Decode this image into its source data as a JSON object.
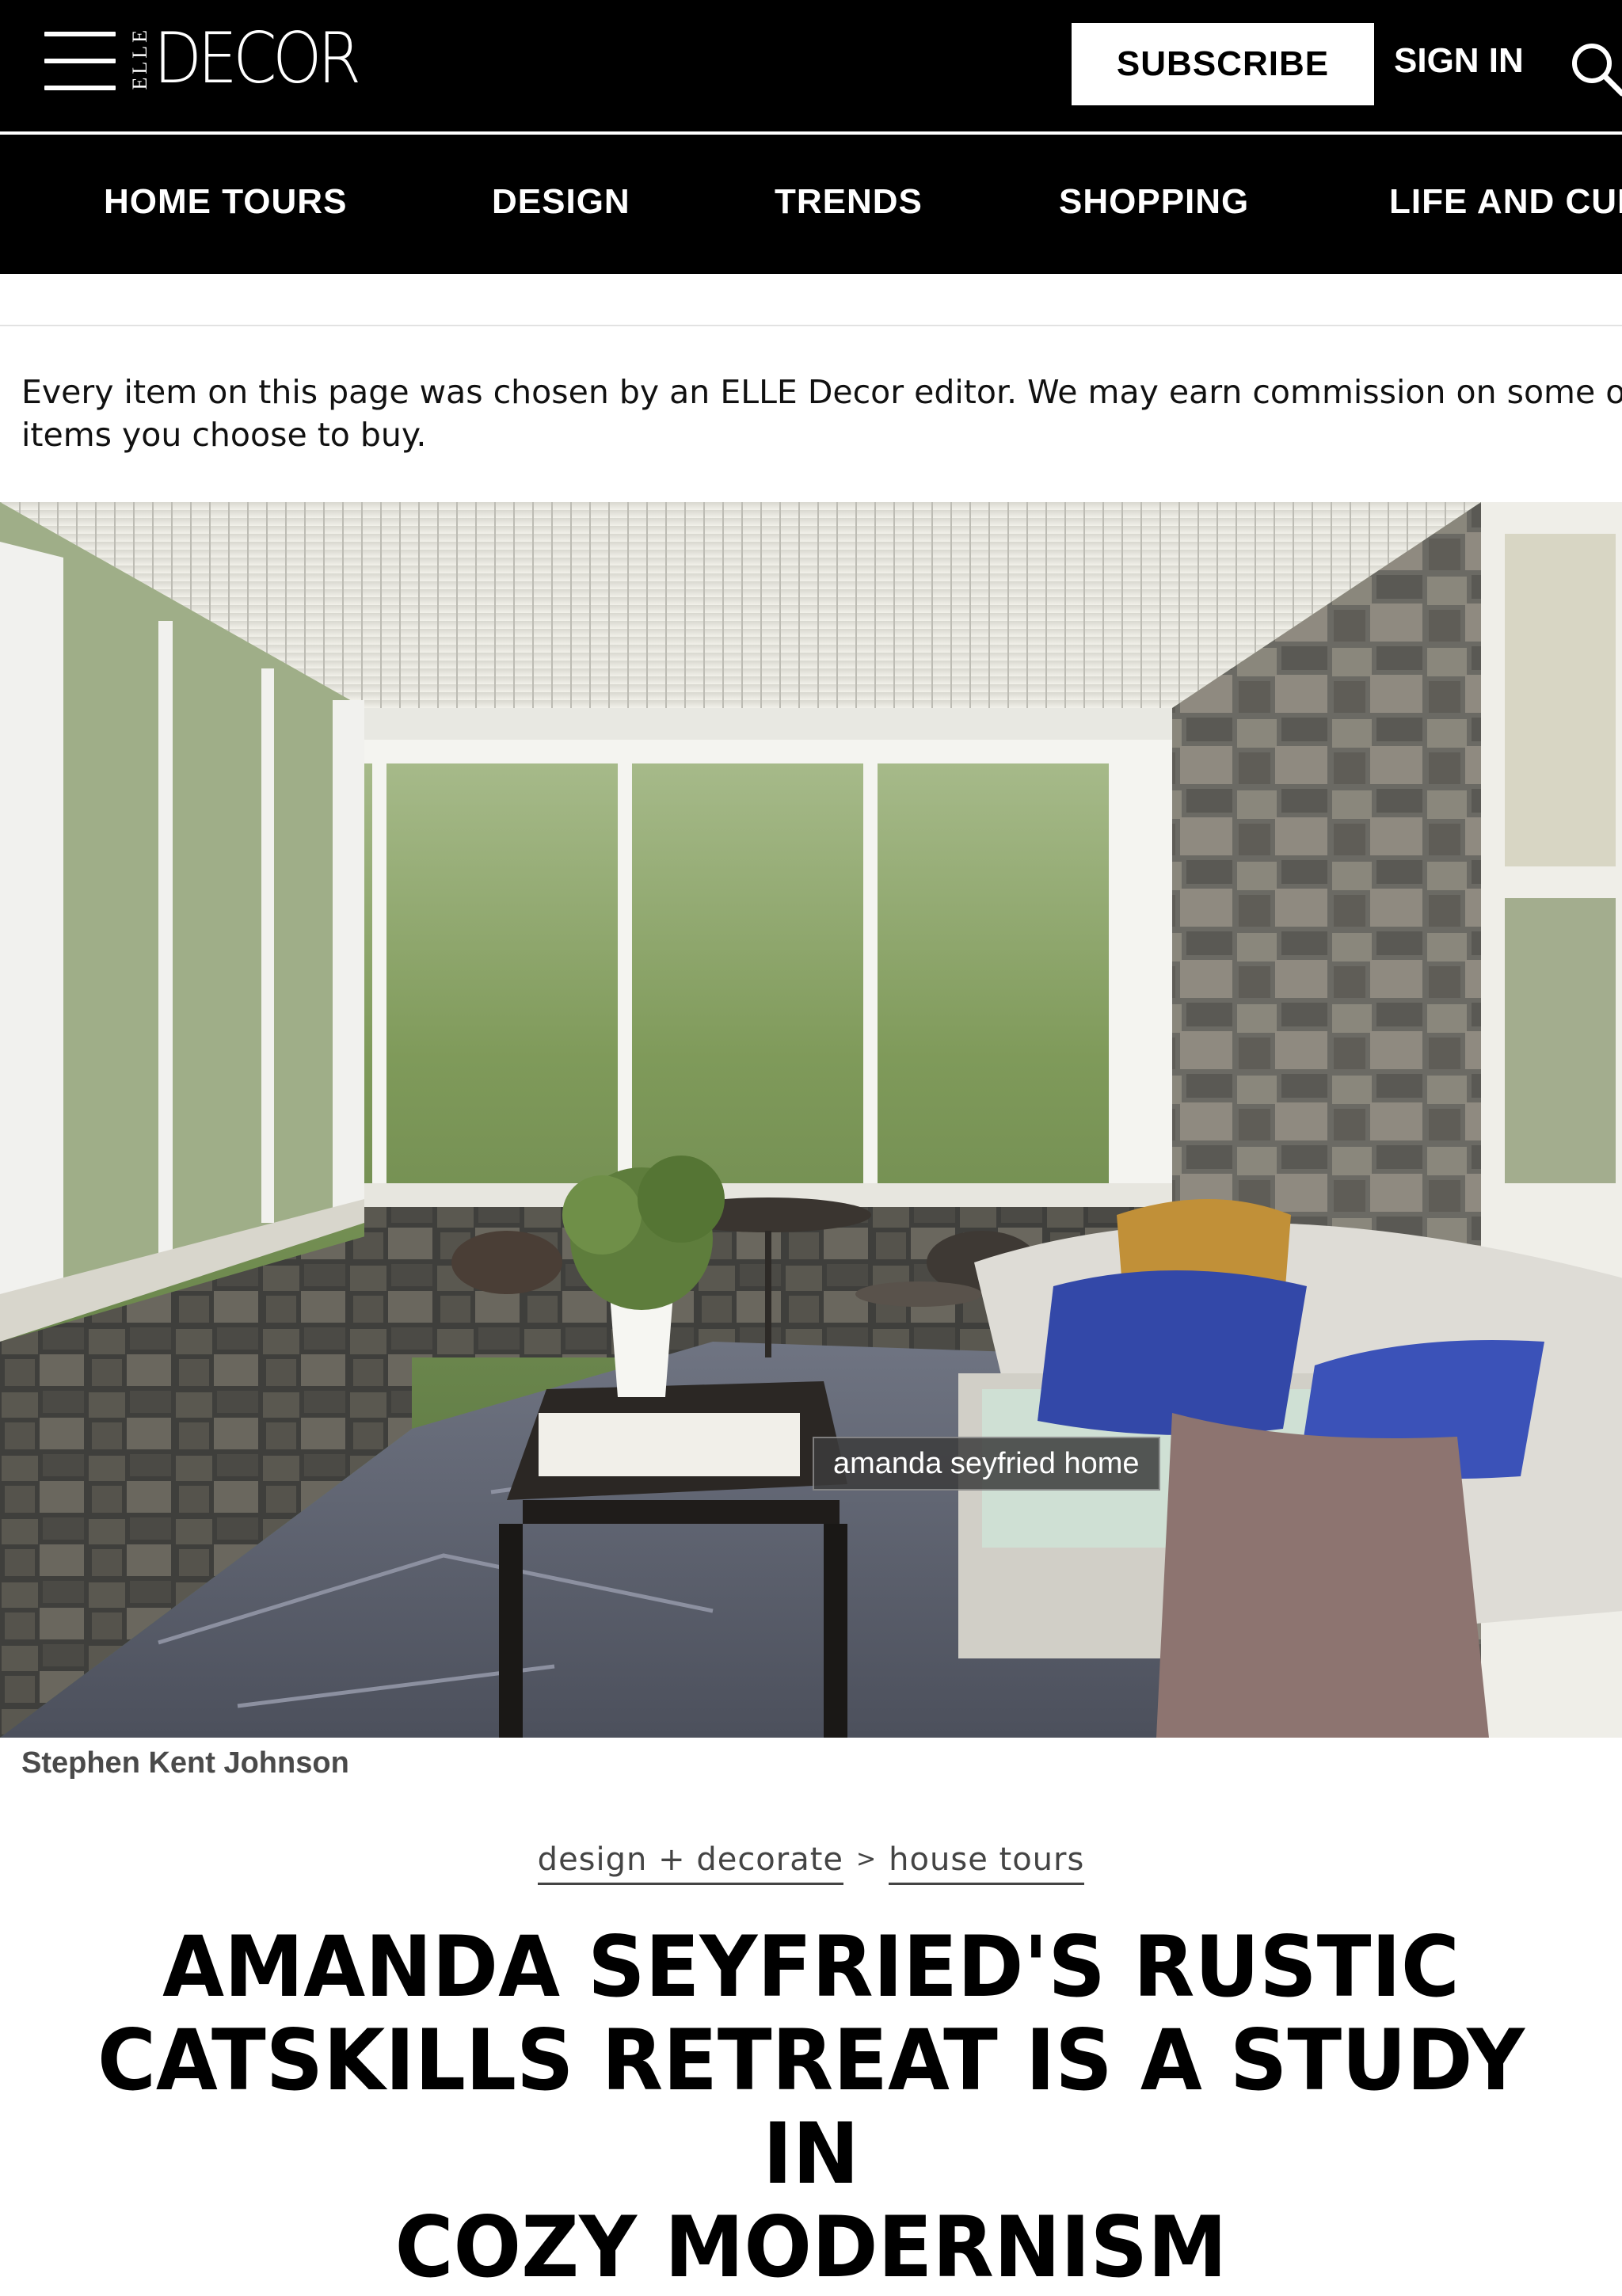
{
  "header": {
    "logo_small": "ELLE",
    "logo_main": "DECOR",
    "subscribe_label": "SUBSCRIBE",
    "signin_label": "SIGN IN",
    "icons": [
      "menu-icon",
      "search-icon"
    ]
  },
  "nav": {
    "items": [
      {
        "label": "HOME TOURS"
      },
      {
        "label": "DESIGN"
      },
      {
        "label": "TRENDS"
      },
      {
        "label": "SHOPPING"
      },
      {
        "label": "LIFE AND CUL"
      }
    ]
  },
  "disclaimer": {
    "line1": "Every item on this page was chosen by an ELLE Decor editor. We may earn commission on some of the",
    "line2": "items you choose to buy."
  },
  "hero": {
    "image_label": "amanda seyfried home",
    "credit": "Stephen Kent Johnson"
  },
  "breadcrumb": {
    "items": [
      {
        "label": "design + decorate"
      },
      {
        "label": "house tours"
      }
    ],
    "separator": ">"
  },
  "article": {
    "headline_line1": "AMANDA SEYFRIED'S RUSTIC",
    "headline_line2": "CATSKILLS RETREAT IS A STUDY IN",
    "headline_line3": "COZY MODERNISM"
  },
  "colors": {
    "header_bg": "#000000",
    "text": "#000000",
    "muted": "#444444"
  }
}
